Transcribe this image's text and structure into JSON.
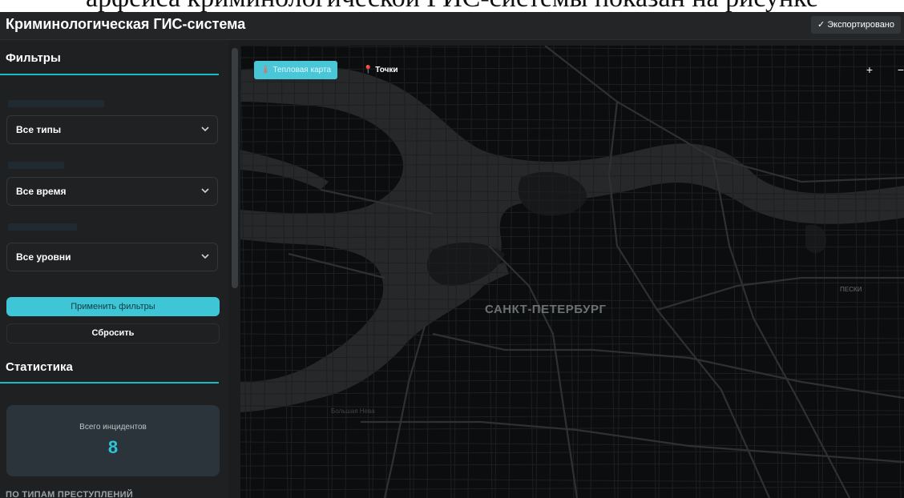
{
  "document_caption": "арфейса криминологической ГИС-системы показан на рисунке",
  "header": {
    "title": "Криминологическая ГИС-система",
    "export_status": "✓ Экспортировано"
  },
  "filters": {
    "title": "Фильтры",
    "crime_type": {
      "value": "Все типы"
    },
    "period": {
      "value": "Все время"
    },
    "severity": {
      "value": "Все уровни"
    },
    "apply_label": "Применить фильтры",
    "reset_label": "Сбросить"
  },
  "statistics": {
    "title": "Статистика",
    "total_label": "Всего инцидентов",
    "total_value": "8",
    "by_type_title": "ПО ТИПАМ ПРЕСТУПЛЕНИЙ"
  },
  "map": {
    "modes": [
      {
        "label": "Тепловая карта",
        "icon": "thermometer-icon",
        "active": true
      },
      {
        "label": "Точки",
        "icon": "pin-icon",
        "active": false
      }
    ],
    "zoom_in": "+",
    "zoom_out": "−",
    "city_label": "САНКТ-ПЕТЕРБУРГ",
    "district_label": "ПЕСКИ",
    "street_label": "Большая Нева"
  },
  "colors": {
    "accent": "#19b9c8",
    "apply_button": "#3ec6d6",
    "map_background": "#0c0d0e",
    "water": "#262829"
  }
}
